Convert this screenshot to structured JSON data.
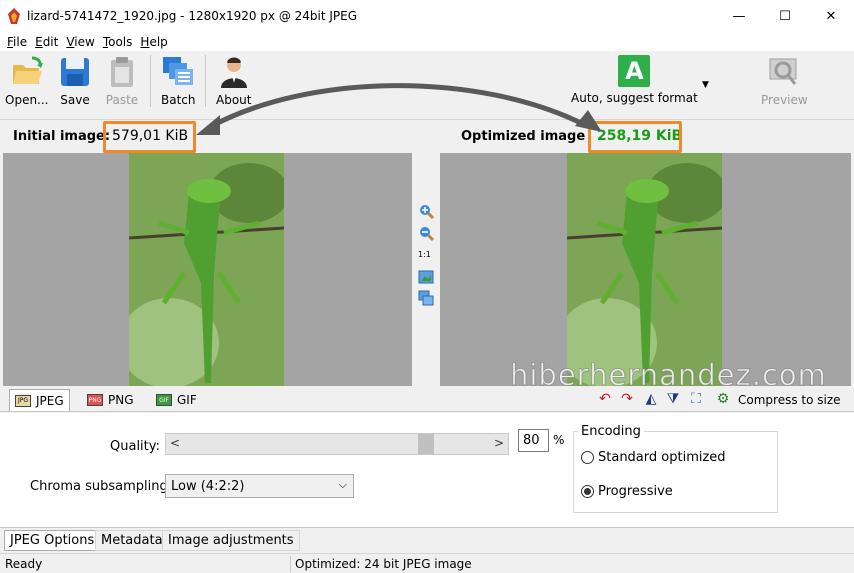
{
  "window": {
    "title": "lizard-5741472_1920.jpg - 1280x1920 px @ 24bit JPEG",
    "minimize": "—",
    "maximize": "☐",
    "close": "✕"
  },
  "menu": [
    "File",
    "Edit",
    "View",
    "Tools",
    "Help"
  ],
  "toolbar": {
    "open": "Open...",
    "save": "Save",
    "paste": "Paste",
    "batch": "Batch",
    "about": "About",
    "auto": "Auto, suggest format",
    "auto_letter": "A",
    "preview": "Preview"
  },
  "sizes": {
    "initial_label": "Initial image:",
    "initial_value": "579,01 KiB",
    "optimized_label": "Optimized image",
    "optimized_value": "258,19 KiB"
  },
  "zoom": {
    "ratio": "1:1"
  },
  "format_tabs": [
    "JPEG",
    "PNG",
    "GIF"
  ],
  "format_icons": [
    "JPG",
    "PNG",
    "GIF"
  ],
  "compress_to_size": "Compress to size",
  "options": {
    "quality_label": "Quality:",
    "quality_value": "80",
    "quality_level": 0.8,
    "quality_unit": "%",
    "chroma_label": "Chroma subsampling:",
    "chroma_value": "Low (4:2:2)",
    "encoding_label": "Encoding",
    "encoding_options": [
      "Standard optimized",
      "Progressive"
    ],
    "encoding_selected": "Progressive"
  },
  "bottom_tabs": [
    "JPEG Options",
    "Metadata",
    "Image adjustments"
  ],
  "status": {
    "left": "Ready",
    "right": "Optimized: 24 bit JPEG image"
  },
  "watermark": "hiberhernandez.com",
  "colors": {
    "accent_orange": "#f0892a",
    "optimized_green": "#1a9c1a",
    "auto_icon_green": "#2eaf4a"
  }
}
